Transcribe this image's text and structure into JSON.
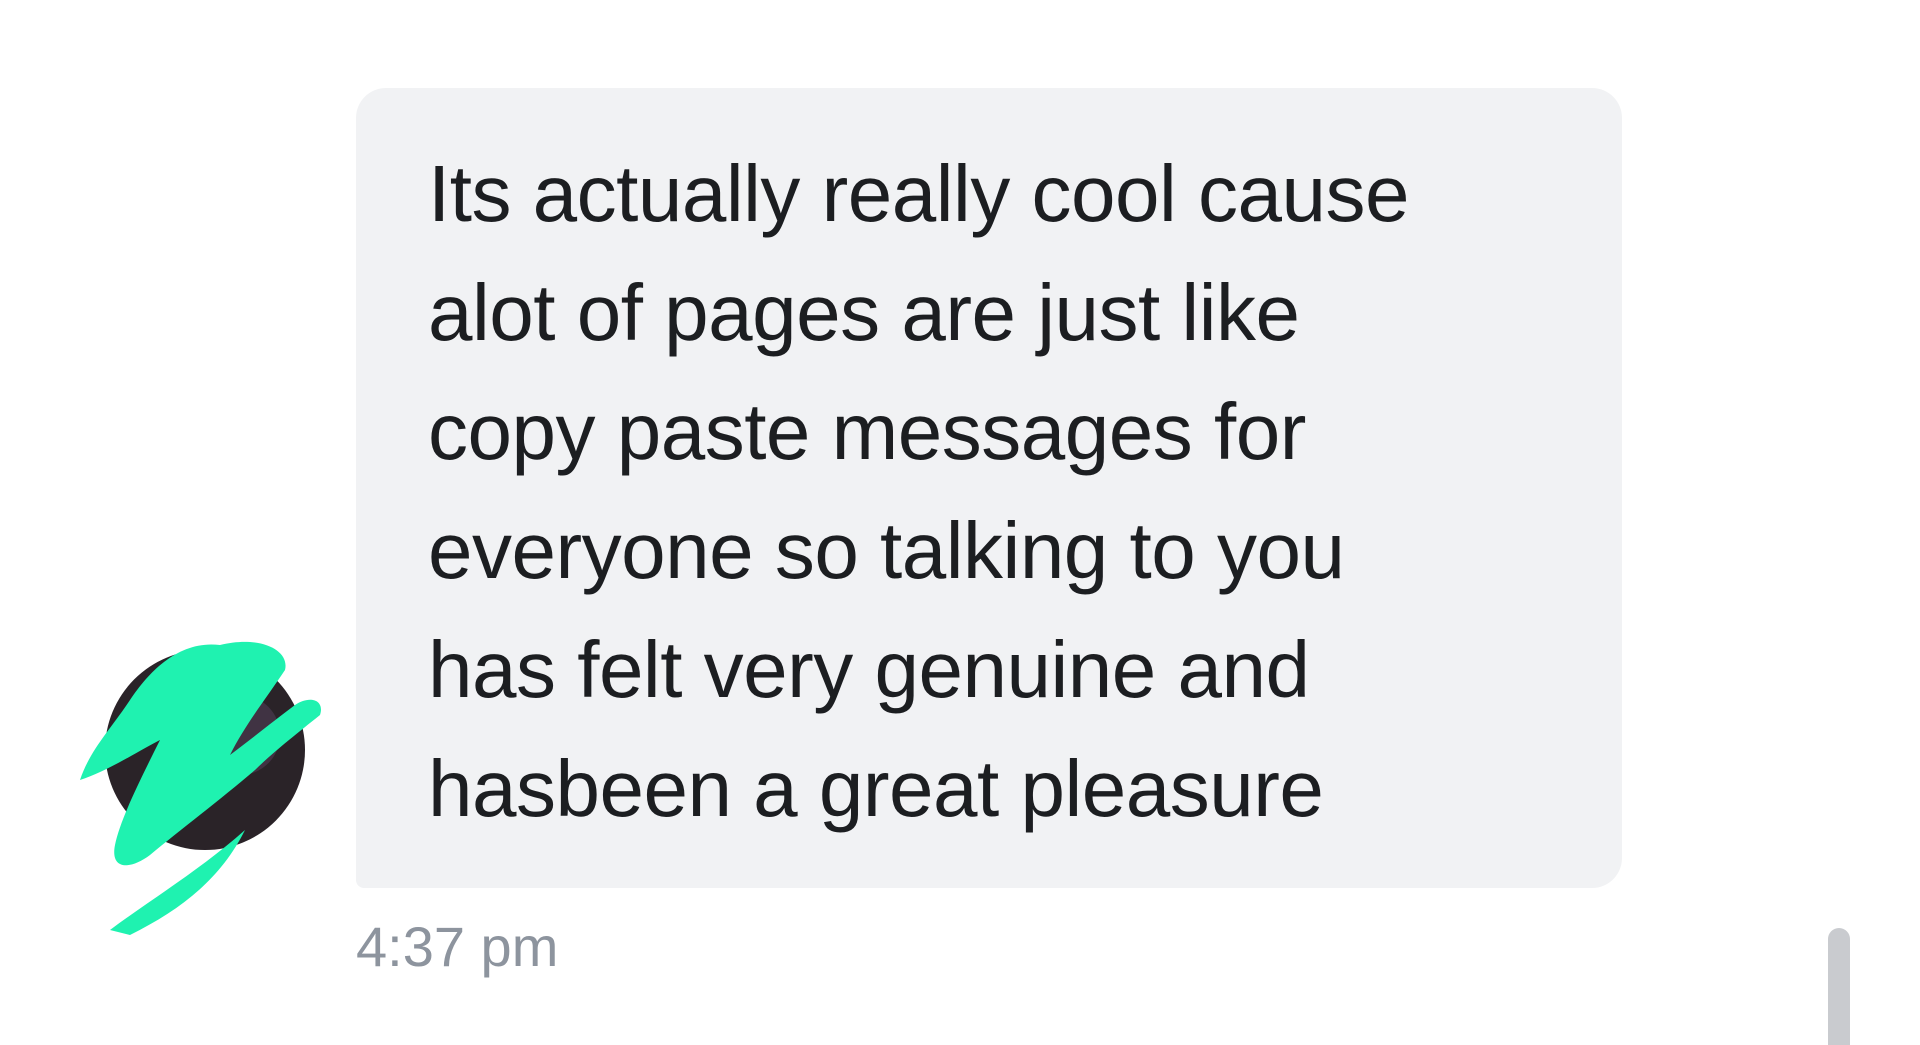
{
  "conversation": {
    "message": {
      "sender_avatar_icon": "avatar-scribbled-out",
      "text": "Its actually really cool cause\nalot of pages are just like\ncopy paste messages for\neveryone so talking to you\nhas felt very genuine and\nhasbeen a great pleasure",
      "timestamp": "4:37 pm"
    }
  },
  "colors": {
    "bubble_bg": "#f1f2f4",
    "text": "#1c1e21",
    "timestamp": "#8d949e",
    "avatar_scribble": "#1ff2b0",
    "scrollbar": "#c9cbcf"
  }
}
